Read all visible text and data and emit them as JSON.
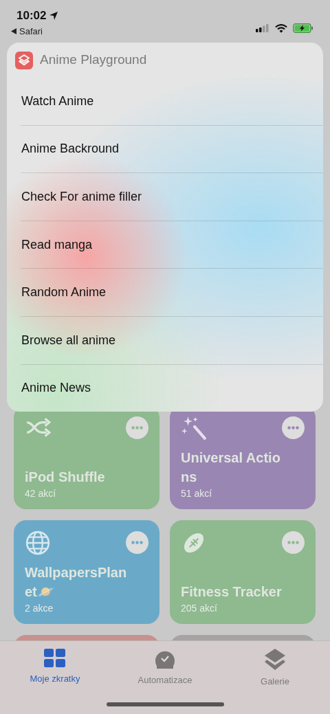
{
  "status_bar": {
    "time": "10:02",
    "back_label": "Safari"
  },
  "menu": {
    "title": "Anime Playground",
    "items": [
      {
        "label": "Watch Anime"
      },
      {
        "label": "Anime Backround"
      },
      {
        "label": "Check For anime filler"
      },
      {
        "label": "Read manga"
      },
      {
        "label": "Random Anime"
      },
      {
        "label": "Browse all anime"
      },
      {
        "label": "Anime News"
      }
    ]
  },
  "tiles": [
    {
      "kind": "full",
      "title": "iPod Shuffle",
      "subtitle": "42 akcí",
      "color": "#8fb98f"
    },
    {
      "kind": "full",
      "title": "Universal Actions",
      "subtitle": "51 akcí",
      "color": "#9a86b2"
    },
    {
      "kind": "full",
      "title": "WallpapersPlanet🪐",
      "subtitle": "2 akce",
      "color": "#6aaac8"
    },
    {
      "kind": "full",
      "title": "Fitness Tracker",
      "subtitle": "205 akcí",
      "color": "#8fb98f"
    },
    {
      "kind": "cut",
      "color": "#c99090"
    },
    {
      "kind": "cut",
      "color": "#a7a3a3"
    }
  ],
  "tab_bar": [
    {
      "label": "Moje zkratky",
      "selected": true
    },
    {
      "label": "Automatizace",
      "selected": false
    },
    {
      "label": "Galerie",
      "selected": false
    }
  ]
}
